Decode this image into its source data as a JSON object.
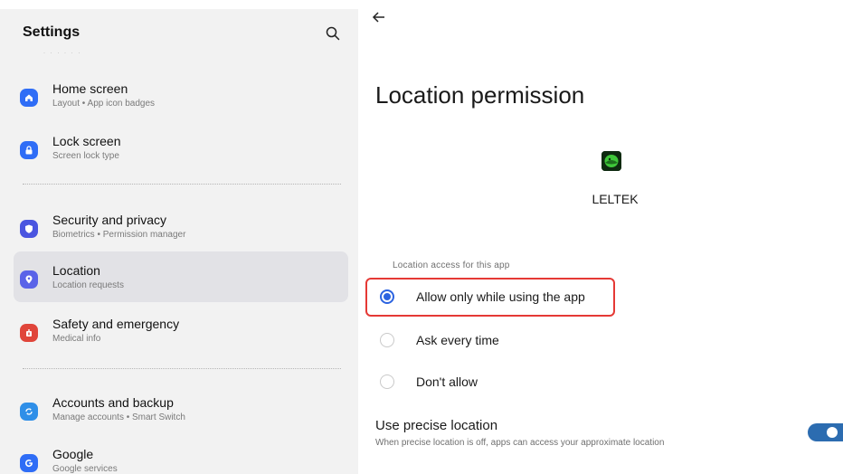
{
  "sidebar": {
    "title": "Settings",
    "items": [
      {
        "label": "Home screen",
        "sub": "Layout  •  App icon badges",
        "icon": "home-icon",
        "color": "#2f6df6"
      },
      {
        "label": "Lock screen",
        "sub": "Screen lock type",
        "icon": "lock-icon",
        "color": "#2f6df6"
      },
      {
        "label": "Security and privacy",
        "sub": "Biometrics  •  Permission manager",
        "icon": "shield-icon",
        "color": "#4a55e0"
      },
      {
        "label": "Location",
        "sub": "Location requests",
        "icon": "location-pin-icon",
        "color": "#5a63e8"
      },
      {
        "label": "Safety and emergency",
        "sub": "Medical info",
        "icon": "emergency-icon",
        "color": "#e0453a"
      },
      {
        "label": "Accounts and backup",
        "sub": "Manage accounts  •  Smart Switch",
        "icon": "sync-icon",
        "color": "#2f8fe8"
      },
      {
        "label": "Google",
        "sub": "Google services",
        "icon": "google-icon",
        "color": "#2f6df6"
      }
    ]
  },
  "main": {
    "title": "Location permission",
    "app_name": "LELTEK",
    "section_label": "Location access for this app",
    "options": [
      {
        "label": "Allow only while using the app",
        "selected": true
      },
      {
        "label": "Ask every time",
        "selected": false
      },
      {
        "label": "Don't allow",
        "selected": false
      }
    ],
    "precise": {
      "title": "Use precise location",
      "desc": "When precise location is off, apps can access your approximate location",
      "enabled": true
    }
  },
  "colors": {
    "accent": "#2b63e0",
    "highlight": "#e53935",
    "toggle": "#2c6cb0"
  }
}
